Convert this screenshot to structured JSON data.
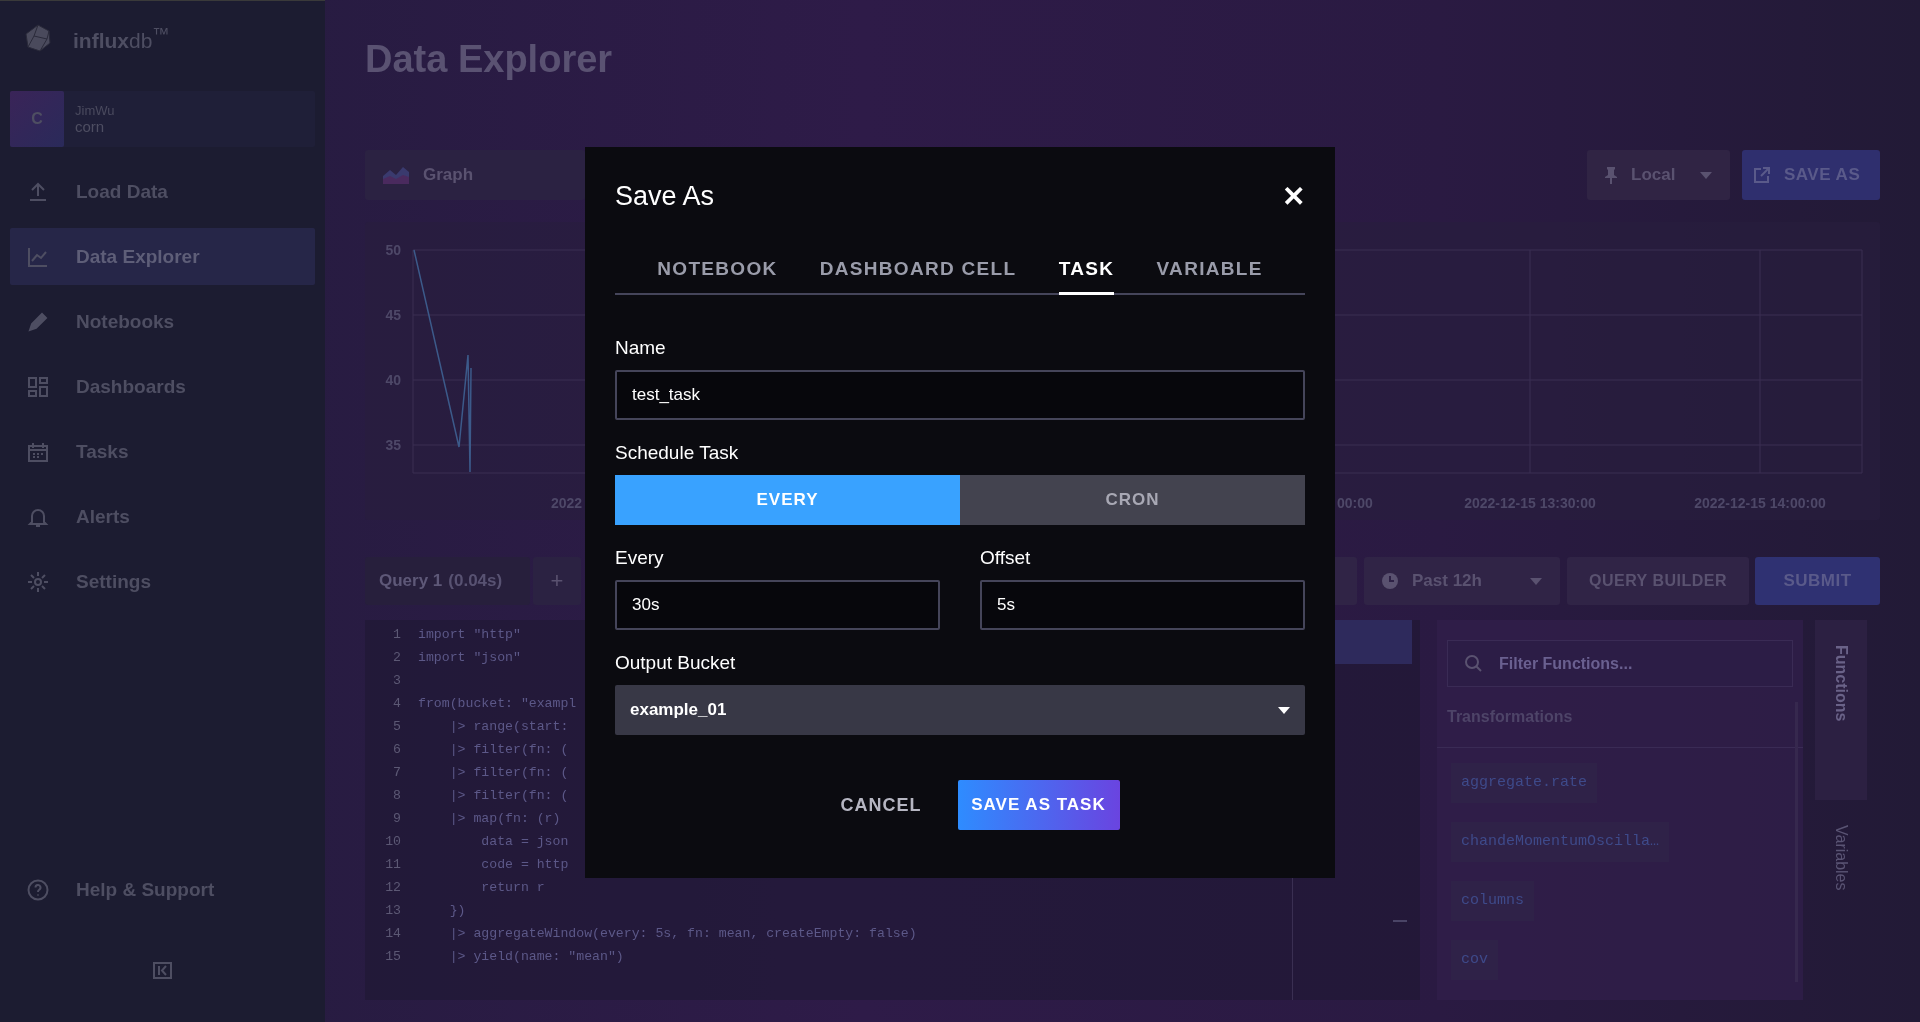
{
  "sidebar": {
    "logo": "**influx**db$^{™}$",
    "user": {
      "avatar": "C",
      "name": "JimWu",
      "org": "corn"
    },
    "items": [
      {
        "label": "Load Data",
        "kind": "upload",
        "selected": false
      },
      {
        "label": "Data Explorer",
        "kind": "chart",
        "selected": true
      },
      {
        "label": "Notebooks",
        "kind": "pencil",
        "selected": false
      },
      {
        "label": "Dashboards",
        "kind": "grid",
        "selected": false
      },
      {
        "label": "Tasks",
        "kind": "calendar",
        "selected": false
      },
      {
        "label": "Alerts",
        "kind": "bell",
        "selected": false
      },
      {
        "label": "Settings",
        "kind": "gear",
        "selected": false
      }
    ],
    "help": {
      "label": "Help & Support"
    }
  },
  "page_title": "Data Explorer",
  "toolbar": {
    "view_type": "Graph",
    "timezone": "Local",
    "save_as": "SAVE AS"
  },
  "chart": {
    "y_ticks": [
      "50",
      "45",
      "40",
      "35"
    ],
    "x_tick_labels": [
      "2022",
      "00:00",
      "2022-12-15 13:30:00",
      "2022-12-15 14:00:00"
    ]
  },
  "query_bar": {
    "query_tab": {
      "name": "Query 1",
      "time": "(0.04s)"
    },
    "add": "+",
    "time_range": "Past 12h",
    "query_builder": "QUERY BUILDER",
    "submit": "SUBMIT"
  },
  "editor": {
    "lines": [
      {
        "number": "1",
        "code": "import \"http\""
      },
      {
        "number": "2",
        "code": "import \"json\""
      },
      {
        "number": "3"
      },
      {
        "number": "4",
        "code": "from(bucket: \"exampl"
      },
      {
        "number": "5",
        "code": "    |> range(start:"
      },
      {
        "number": "6",
        "code": "    |> filter(fn: ("
      },
      {
        "number": "7",
        "code": "    |> filter(fn: ("
      },
      {
        "number": "8",
        "code": "    |> filter(fn: ("
      },
      {
        "number": "9",
        "code": "    |> map(fn: (r)"
      },
      {
        "number": "10",
        "code": "        data = json"
      },
      {
        "number": "11",
        "code": "        code = http"
      },
      {
        "number": "12",
        "code": "        return r"
      },
      {
        "number": "13",
        "code": "    })"
      },
      {
        "number": "14",
        "code": "    |> aggregateWindow(every: 5s, fn: mean, createEmpty: false)"
      },
      {
        "number": "15",
        "code": "    |> yield(name: \"mean\")"
      }
    ]
  },
  "functions_panel": {
    "search": {
      "placeholder": "Filter Functions..."
    },
    "section": "Transformations",
    "items": [
      "aggregate.rate",
      "chandeMomentumOscilla…",
      "columns",
      "cov"
    ]
  },
  "side_tabs": [
    {
      "label": "Functions",
      "selected": true
    },
    {
      "label": "Variables",
      "selected": false
    }
  ],
  "dialog": {
    "title": "Save As",
    "close": "✕",
    "tabs": [
      {
        "label": "NOTEBOOK",
        "selected": false
      },
      {
        "label": "DASHBOARD CELL",
        "selected": false
      },
      {
        "label": "TASK",
        "selected": true
      },
      {
        "label": "VARIABLE",
        "selected": false
      }
    ],
    "name": {
      "label": "Name",
      "value": "test_task"
    },
    "schedule": {
      "label": "Schedule Task",
      "options": [
        {
          "label": "EVERY",
          "selected": true
        },
        {
          "label": "CRON",
          "selected": false
        }
      ]
    },
    "every": {
      "label": "Every",
      "value": "30s"
    },
    "offset": {
      "label": "Offset",
      "value": "5s"
    },
    "bucket": {
      "label": "Output Bucket",
      "value": "example_01"
    },
    "buttons": {
      "cancel": "CANCEL",
      "submit": "SAVE AS TASK"
    }
  }
}
